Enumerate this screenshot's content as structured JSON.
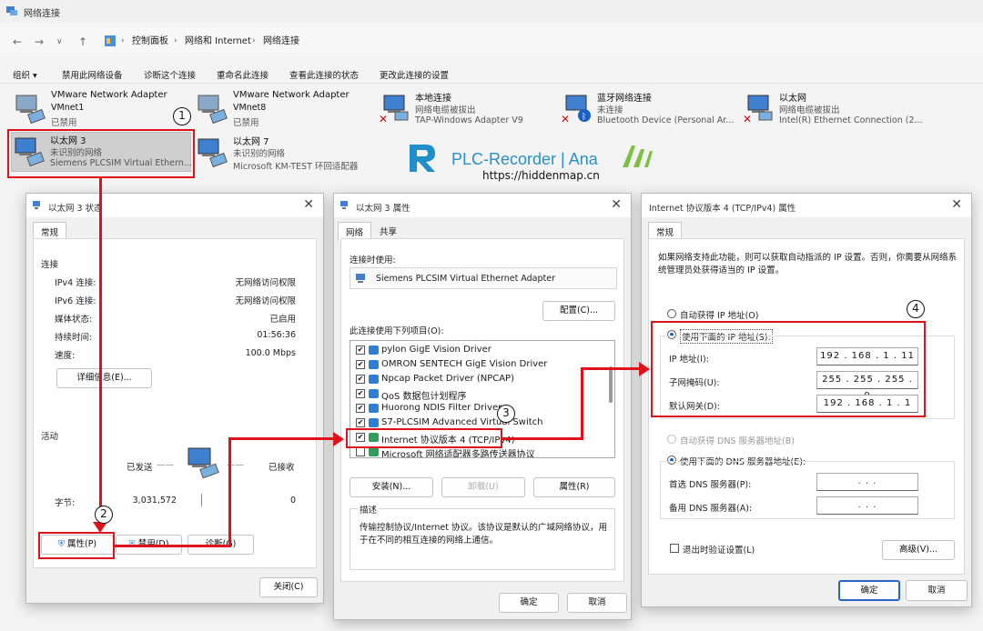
{
  "window": {
    "title": "网络连接"
  },
  "address": {
    "crumbs": [
      "控制面板",
      "网络和 Internet",
      "网络连接"
    ]
  },
  "toolbar": {
    "items": [
      "组织 ▾",
      "禁用此网络设备",
      "诊断这个连接",
      "重命名此连接",
      "查看此连接的状态",
      "更改此连接的设置"
    ]
  },
  "connections": [
    {
      "name": "VMware Network Adapter",
      "line2": "VMnet1",
      "line3": "已禁用"
    },
    {
      "name": "VMware Network Adapter",
      "line2": "VMnet8",
      "line3": "已禁用"
    },
    {
      "name": "本地连接",
      "line2": "网络电缆被拔出",
      "line3": "TAP-Windows Adapter V9"
    },
    {
      "name": "蓝牙网络连接",
      "line2": "未连接",
      "line3": "Bluetooth Device (Personal Ar..."
    },
    {
      "name": "以太网",
      "line2": "网络电缆被拔出",
      "line3": "Intel(R) Ethernet Connection (2..."
    },
    {
      "name": "以太网 3",
      "line2": "未识别的网络",
      "line3": "Siemens PLCSIM Virtual Ethern..."
    },
    {
      "name": "以太网 7",
      "line2": "未识别的网络",
      "line3": "Microsoft KM-TEST 环回适配器"
    }
  ],
  "watermark": {
    "brand": "PLC-Recorder | Ana",
    "url": "https://hiddenmap.cn"
  },
  "status_dialog": {
    "title": "以太网 3 状态",
    "tab": "常规",
    "section_conn": "连接",
    "rows": [
      {
        "label": "IPv4 连接:",
        "value": "无网络访问权限"
      },
      {
        "label": "IPv6 连接:",
        "value": "无网络访问权限"
      },
      {
        "label": "媒体状态:",
        "value": "已启用"
      },
      {
        "label": "持续时间:",
        "value": "01:56:36"
      },
      {
        "label": "速度:",
        "value": "100.0 Mbps"
      }
    ],
    "details_btn": "详细信息(E)...",
    "section_activity": "活动",
    "sent_label": "已发送",
    "recv_label": "已接收",
    "bytes_label": "字节:",
    "bytes_sent": "3,031,572",
    "bytes_recv": "0",
    "btn_props": "属性(P)",
    "btn_disable": "禁用(D)",
    "btn_diag": "诊断(G)",
    "btn_close": "关闭(C)"
  },
  "props_dialog": {
    "title": "以太网 3 属性",
    "tabs": [
      "网络",
      "共享"
    ],
    "connect_using": "连接时使用:",
    "adapter": "Siemens PLCSIM Virtual Ethernet Adapter",
    "configure_btn": "配置(C)...",
    "items_label": "此连接使用下列项目(O):",
    "items": [
      "pylon GigE Vision Driver",
      "OMRON SENTECH GigE Vision Driver",
      "Npcap Packet Driver (NPCAP)",
      "QoS 数据包计划程序",
      "Huorong NDIS Filter Driver",
      "S7-PLCSIM Advanced Virtual Switch",
      "Internet 协议版本 4 (TCP/IPv4)",
      "Microsoft 网络适配器多路传送器协议"
    ],
    "btn_install": "安装(N)...",
    "btn_uninstall": "卸载(U)",
    "btn_props": "属性(R)",
    "desc_label": "描述",
    "desc": "传输控制协议/Internet 协议。该协议是默认的广域网络协议，用于在不同的相互连接的网络上通信。",
    "btn_ok": "确定",
    "btn_cancel": "取消"
  },
  "ipv4_dialog": {
    "title": "Internet 协议版本 4 (TCP/IPv4) 属性",
    "tab": "常规",
    "intro": "如果网络支持此功能，则可以获取自动指派的 IP 设置。否则，你需要从网络系统管理员处获得适当的 IP 设置。",
    "auto_ip": "自动获得 IP 地址(O)",
    "manual_ip": "使用下面的 IP 地址(S):",
    "ip_label": "IP 地址(I):",
    "ip": "192 . 168 .  1  . 11",
    "mask_label": "子网掩码(U):",
    "mask": "255 . 255 . 255 .  0",
    "gw_label": "默认网关(D):",
    "gw": "192 . 168 .  1  .  1",
    "auto_dns": "自动获得 DNS 服务器地址(B)",
    "manual_dns": "使用下面的 DNS 服务器地址(E):",
    "dns1_label": "首选 DNS 服务器(P):",
    "dns2_label": "备用 DNS 服务器(A):",
    "dns_empty": ".       .       .",
    "validate": "退出时验证设置(L)",
    "advanced": "高级(V)...",
    "btn_ok": "确定",
    "btn_cancel": "取消"
  },
  "steps": [
    "1",
    "2",
    "3",
    "4"
  ]
}
